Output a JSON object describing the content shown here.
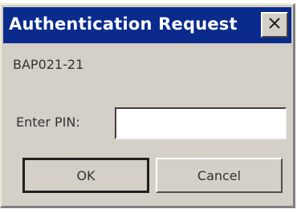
{
  "window": {
    "title": "Authentication Request",
    "close_icon": "close-icon"
  },
  "device": {
    "id": "BAP021-21"
  },
  "form": {
    "pin_label": "Enter PIN:",
    "pin_value": "",
    "pin_placeholder": ""
  },
  "buttons": {
    "ok_label": "OK",
    "cancel_label": "Cancel"
  },
  "colors": {
    "titlebar": "#0a2a8c",
    "dialog_bg": "#d4d0c8",
    "title_text": "#ffffff"
  }
}
